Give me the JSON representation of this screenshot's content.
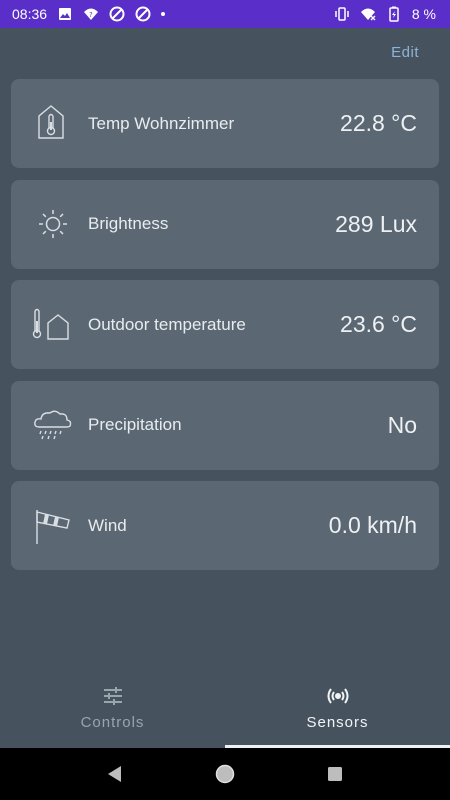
{
  "status_bar": {
    "time": "08:36",
    "battery": "8 %",
    "left_icons": [
      "image-icon",
      "wifi-question-icon",
      "do-not-disturb-icon",
      "do-not-disturb-icon",
      "dot-icon"
    ],
    "right_icons": [
      "vibrate-icon",
      "wifi-icon",
      "battery-icon"
    ],
    "bg_color": "#5a2ec8"
  },
  "header": {
    "edit_label": "Edit",
    "accent_color": "#8fb3d6"
  },
  "sensors": [
    {
      "icon": "thermometer-house-icon",
      "label": "Temp Wohnzimmer",
      "value": "22.8 °C"
    },
    {
      "icon": "sun-icon",
      "label": "Brightness",
      "value": "289 Lux"
    },
    {
      "icon": "outdoor-thermometer-icon",
      "label": "Outdoor temperature",
      "value": "23.6 °C"
    },
    {
      "icon": "cloud-rain-icon",
      "label": "Precipitation",
      "value": "No"
    },
    {
      "icon": "windsock-icon",
      "label": "Wind",
      "value": "0.0 km/h"
    }
  ],
  "bottom_nav": {
    "tabs": [
      {
        "label": "Controls",
        "icon": "sliders-icon",
        "active": false
      },
      {
        "label": "Sensors",
        "icon": "broadcast-icon",
        "active": true
      }
    ]
  },
  "system_nav": {
    "buttons": [
      "back-icon",
      "home-icon",
      "recents-icon"
    ]
  }
}
